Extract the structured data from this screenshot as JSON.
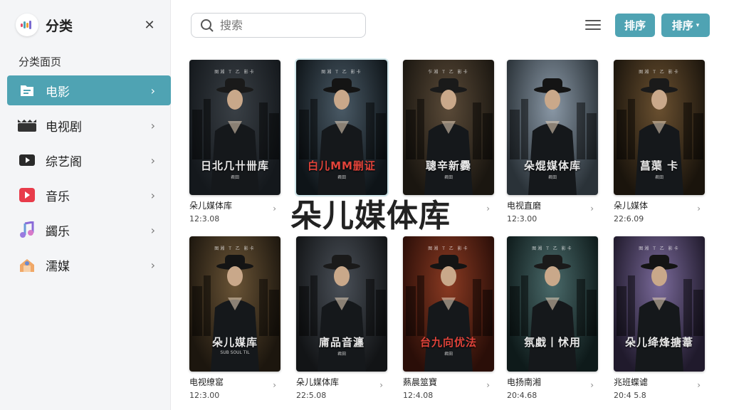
{
  "sidebar": {
    "title": "分类",
    "section": "分类面页",
    "items": [
      {
        "label": "电影",
        "icon": "movie-folder-icon",
        "active": true
      },
      {
        "label": "电视剧",
        "icon": "tv-icon",
        "active": false
      },
      {
        "label": "综艺阁",
        "icon": "play-icon",
        "active": false
      },
      {
        "label": "音乐",
        "icon": "music-play-icon",
        "active": false
      },
      {
        "label": "蠲乐",
        "icon": "music-note-icon",
        "active": false
      },
      {
        "label": "濡媒",
        "icon": "media-icon",
        "active": false
      }
    ]
  },
  "search": {
    "placeholder": "搜索"
  },
  "toolbar": {
    "sort_label": "排序",
    "sort_dropdown_label": "排序"
  },
  "overlay_title": "朵儿媒体库",
  "accent": "#4fa3b3",
  "cards": [
    {
      "poster_title": "日北几卄卌库",
      "poster_sub": "君田",
      "credits": "图湘 T 乙 影卡",
      "name": "朵儿媒体库",
      "date": "12:3.08",
      "palette": [
        "#3a4046",
        "#14181c"
      ],
      "title_red": false
    },
    {
      "poster_title": "白儿MM删证",
      "poster_sub": "君田",
      "credits": "图湘 T 乙 影卡",
      "name": "",
      "date": "",
      "palette": [
        "#4a5a66",
        "#0e1418"
      ],
      "title_red": true
    },
    {
      "poster_title": "聰辛新爨",
      "poster_sub": "君田",
      "credits": "乍湘 T 乙 影卡",
      "name": "",
      "date": "",
      "palette": [
        "#5a4a38",
        "#1a1610"
      ],
      "title_red": false
    },
    {
      "poster_title": "朵焜媒体库",
      "poster_sub": "君田",
      "credits": "",
      "name": "电视直磨",
      "date": "12:3.00",
      "palette": [
        "#8a98a6",
        "#2a3238"
      ],
      "title_red": false
    },
    {
      "poster_title": "菖蕖 卡",
      "poster_sub": "君田",
      "credits": "图湘 T 乙 影卡",
      "name": "朵儿媒体",
      "date": "22:6.09",
      "palette": [
        "#6a5030",
        "#1a140c"
      ],
      "title_red": false
    },
    {
      "poster_title": "朵儿媒库",
      "poster_sub": "SUB SOUL TIL",
      "credits": "图湘 T 乙 影卡",
      "name": "电视缭窰",
      "date": "12:3.00",
      "palette": [
        "#6a5436",
        "#1c160e"
      ],
      "title_red": false
    },
    {
      "poster_title": "庯品音瀍",
      "poster_sub": "君田",
      "credits": "",
      "name": "朵儿媒体库",
      "date": "22:5.08",
      "palette": [
        "#4a5058",
        "#121416"
      ],
      "title_red": false
    },
    {
      "poster_title": "台九向优法",
      "poster_sub": "君田",
      "credits": "图湘 T 乙 影卡",
      "name": "爇晨筮寶",
      "date": "12:4.08",
      "palette": [
        "#8a3a22",
        "#2a0e08"
      ],
      "title_red": true
    },
    {
      "poster_title": "氛戱丨怵用",
      "poster_sub": "",
      "credits": "图湘 T 乙 影卡",
      "name": "电扬南湘",
      "date": "20:4.68",
      "palette": [
        "#4a6a6a",
        "#0e1a1a"
      ],
      "title_red": false
    },
    {
      "poster_title": "朵儿绛烽搪葦",
      "poster_sub": "",
      "credits": "图湘 T 乙 影卡",
      "name": "兆班蝶谑",
      "date": "20:4 5.8",
      "palette": [
        "#7a6a9a",
        "#201a2c"
      ],
      "title_red": false
    }
  ]
}
